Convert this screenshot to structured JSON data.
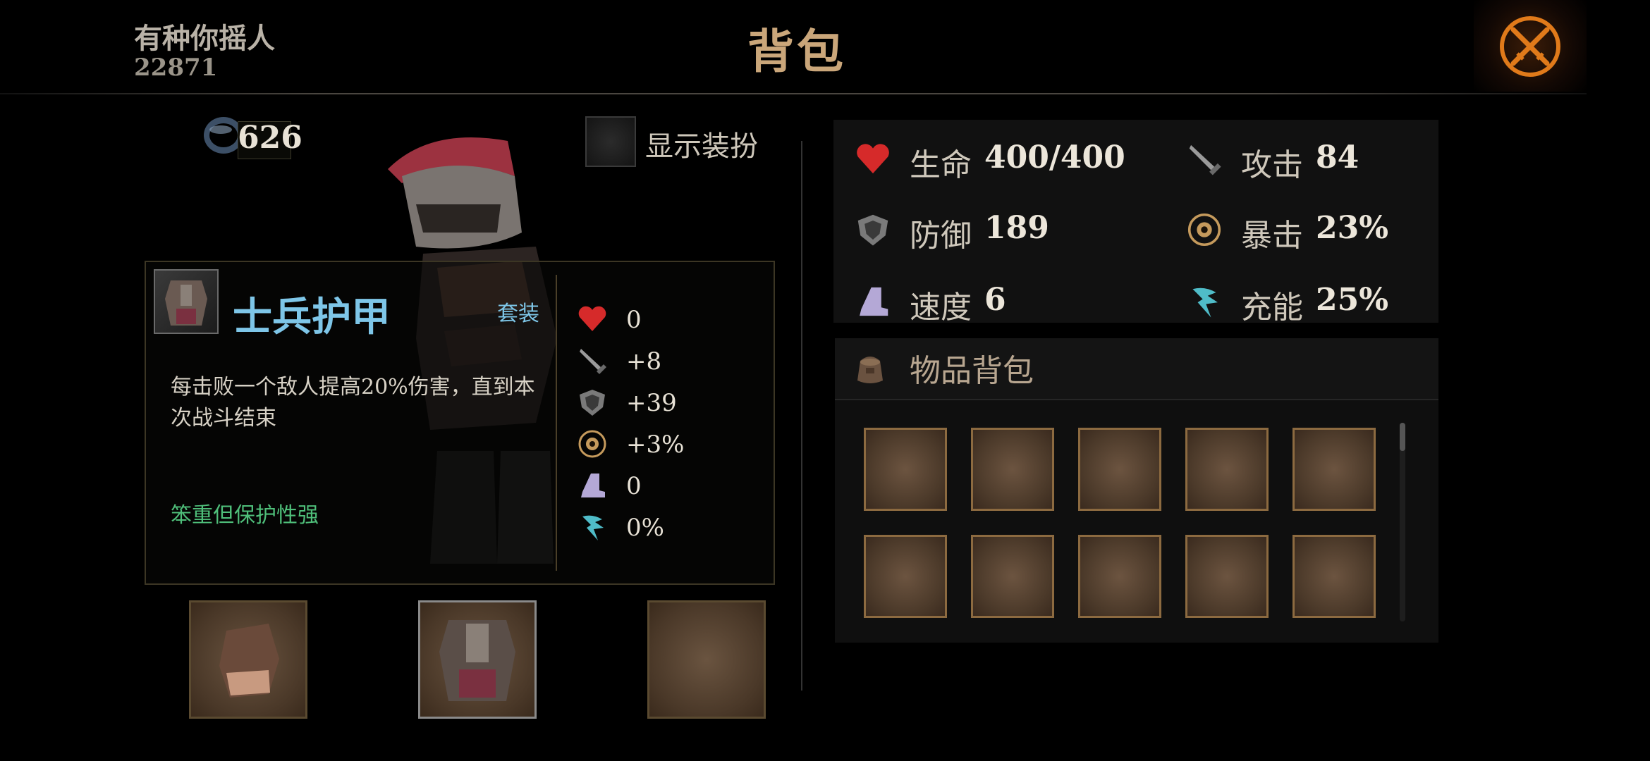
{
  "player": {
    "name": "有种你摇人",
    "id": "22871"
  },
  "title": "背包",
  "currency": {
    "value": "626",
    "icon": "ring-coin-icon"
  },
  "show_costume": {
    "label": "显示装扮",
    "checked": false
  },
  "item": {
    "name": "士兵护甲",
    "set_tag": "套装",
    "description": "每击败一个敌人提高20%伤害，直到本次战斗结束",
    "flavor": "笨重但保护性强",
    "stats": [
      {
        "icon": "heart-icon",
        "value": "0"
      },
      {
        "icon": "sword-icon",
        "value": "+8"
      },
      {
        "icon": "shield-icon",
        "value": "+39"
      },
      {
        "icon": "crit-icon",
        "value": "+3%"
      },
      {
        "icon": "boot-icon",
        "value": "0"
      },
      {
        "icon": "energy-icon",
        "value": "0%"
      }
    ]
  },
  "equipment_slots": [
    {
      "item": "gauntlet",
      "filled": true
    },
    {
      "item": "soldier-armor",
      "filled": true
    },
    {
      "item": "",
      "filled": false
    }
  ],
  "stats": [
    {
      "icon": "heart-icon",
      "label": "生命",
      "value": "400/400"
    },
    {
      "icon": "sword-icon",
      "label": "攻击",
      "value": "84"
    },
    {
      "icon": "shield-icon",
      "label": "防御",
      "value": "189"
    },
    {
      "icon": "crit-icon",
      "label": "暴击",
      "value": "23%"
    },
    {
      "icon": "boot-icon",
      "label": "速度",
      "value": "6"
    },
    {
      "icon": "energy-icon",
      "label": "充能",
      "value": "25%"
    }
  ],
  "inventory": {
    "title": "物品背包",
    "slot_count": 10
  },
  "colors": {
    "title": "#caa67a",
    "item_name": "#7ec6e8",
    "flavor": "#4fbf7a",
    "slot_border": "#8c6a40",
    "close_accent": "#e07a1a"
  }
}
